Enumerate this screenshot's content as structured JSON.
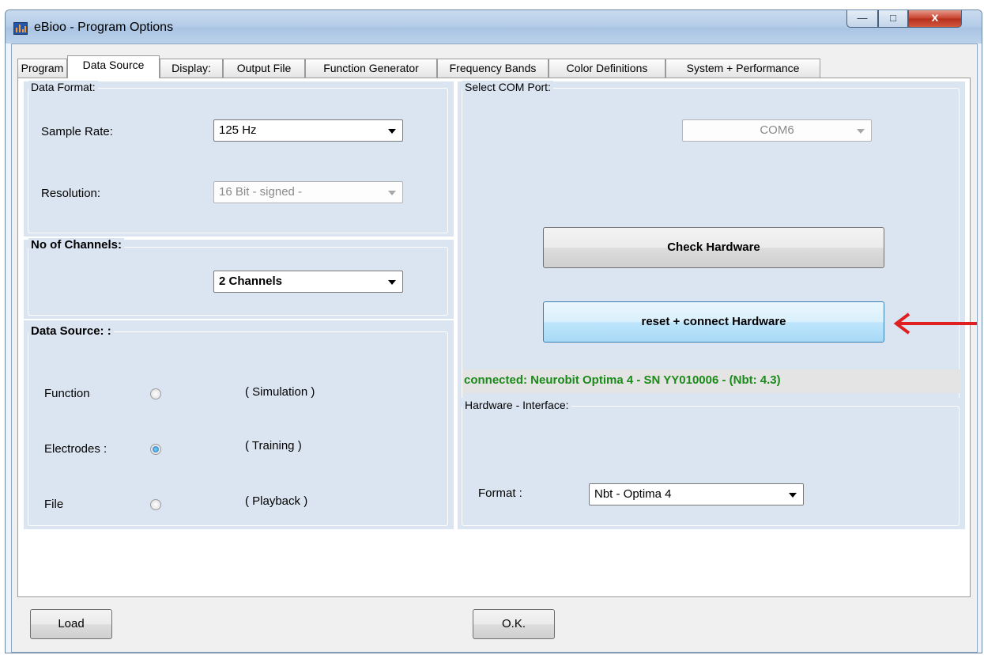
{
  "window": {
    "title": "eBioo - Program Options",
    "controls": {
      "minimize": "—",
      "maximize": "□",
      "close": "x"
    }
  },
  "tabs": [
    "Program",
    "Data Source",
    "Display:",
    "Output File",
    "Function Generator",
    "Frequency Bands",
    "Color Definitions",
    "System + Performance"
  ],
  "active_tab": "Data Source",
  "data_format": {
    "title": "Data Format:",
    "sample_rate_label": "Sample Rate:",
    "sample_rate_value": "125 Hz",
    "resolution_label": "Resolution:",
    "resolution_value": "16 Bit - signed -"
  },
  "channels": {
    "title": "No of Channels:",
    "value": "2 Channels"
  },
  "data_source": {
    "title": "Data Source: :",
    "options": [
      {
        "label": "Function",
        "desc": "( Simulation )",
        "checked": false
      },
      {
        "label": "Electrodes :",
        "desc": "( Training )",
        "checked": true
      },
      {
        "label": "File",
        "desc": "( Playback )",
        "checked": false
      }
    ]
  },
  "com_port": {
    "title": "Select COM Port:",
    "value": "COM6"
  },
  "buttons": {
    "check_hardware": "Check Hardware",
    "reset_connect": "reset + connect Hardware",
    "load": "Load",
    "ok": "O.K."
  },
  "status": {
    "text": "connected: Neurobit Optima 4 - SN YY010006 - (Nbt: 4.3)",
    "color": "#1a8a1a"
  },
  "hardware_interface": {
    "title": "Hardware - Interface:",
    "format_label": "Format :",
    "format_value": "Nbt - Optima 4"
  },
  "colors": {
    "panel": "#dbe5f1",
    "arrow": "#e02020"
  }
}
